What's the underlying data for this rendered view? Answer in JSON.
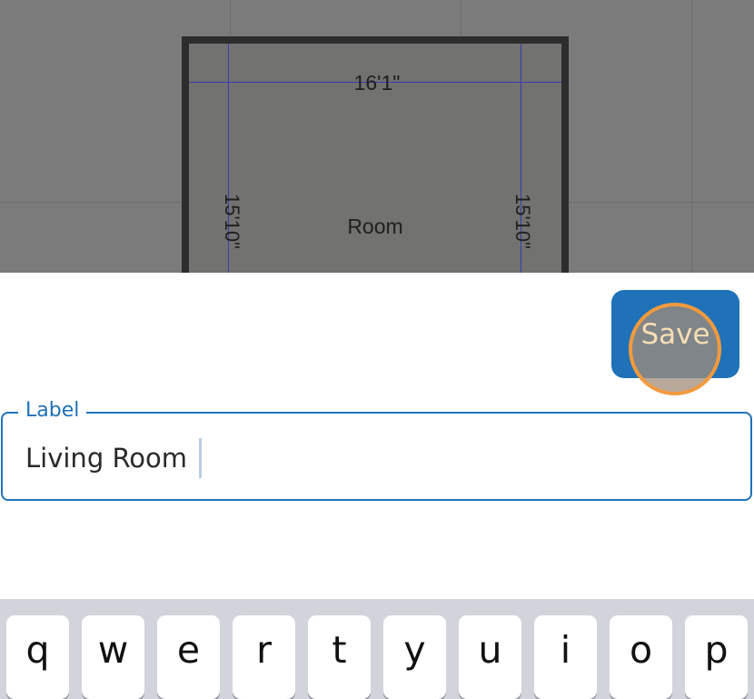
{
  "floorplan": {
    "top_dimension": "16'1\"",
    "left_dimension": "15'10\"",
    "right_dimension": "15'10\"",
    "room_label": "Room"
  },
  "toolbar": {
    "save_label": "Save"
  },
  "label_field": {
    "legend": "Label",
    "value": "Living Room"
  },
  "keyboard": {
    "row1": [
      "q",
      "w",
      "e",
      "r",
      "t",
      "y",
      "u",
      "i",
      "o",
      "p"
    ]
  },
  "colors": {
    "accent": "#1f72b8",
    "tap_indicator": "#f39a3d",
    "canvas": "#7b7b7b",
    "wall": "#2d2d2d",
    "dimension_line": "#3a3ab0"
  }
}
